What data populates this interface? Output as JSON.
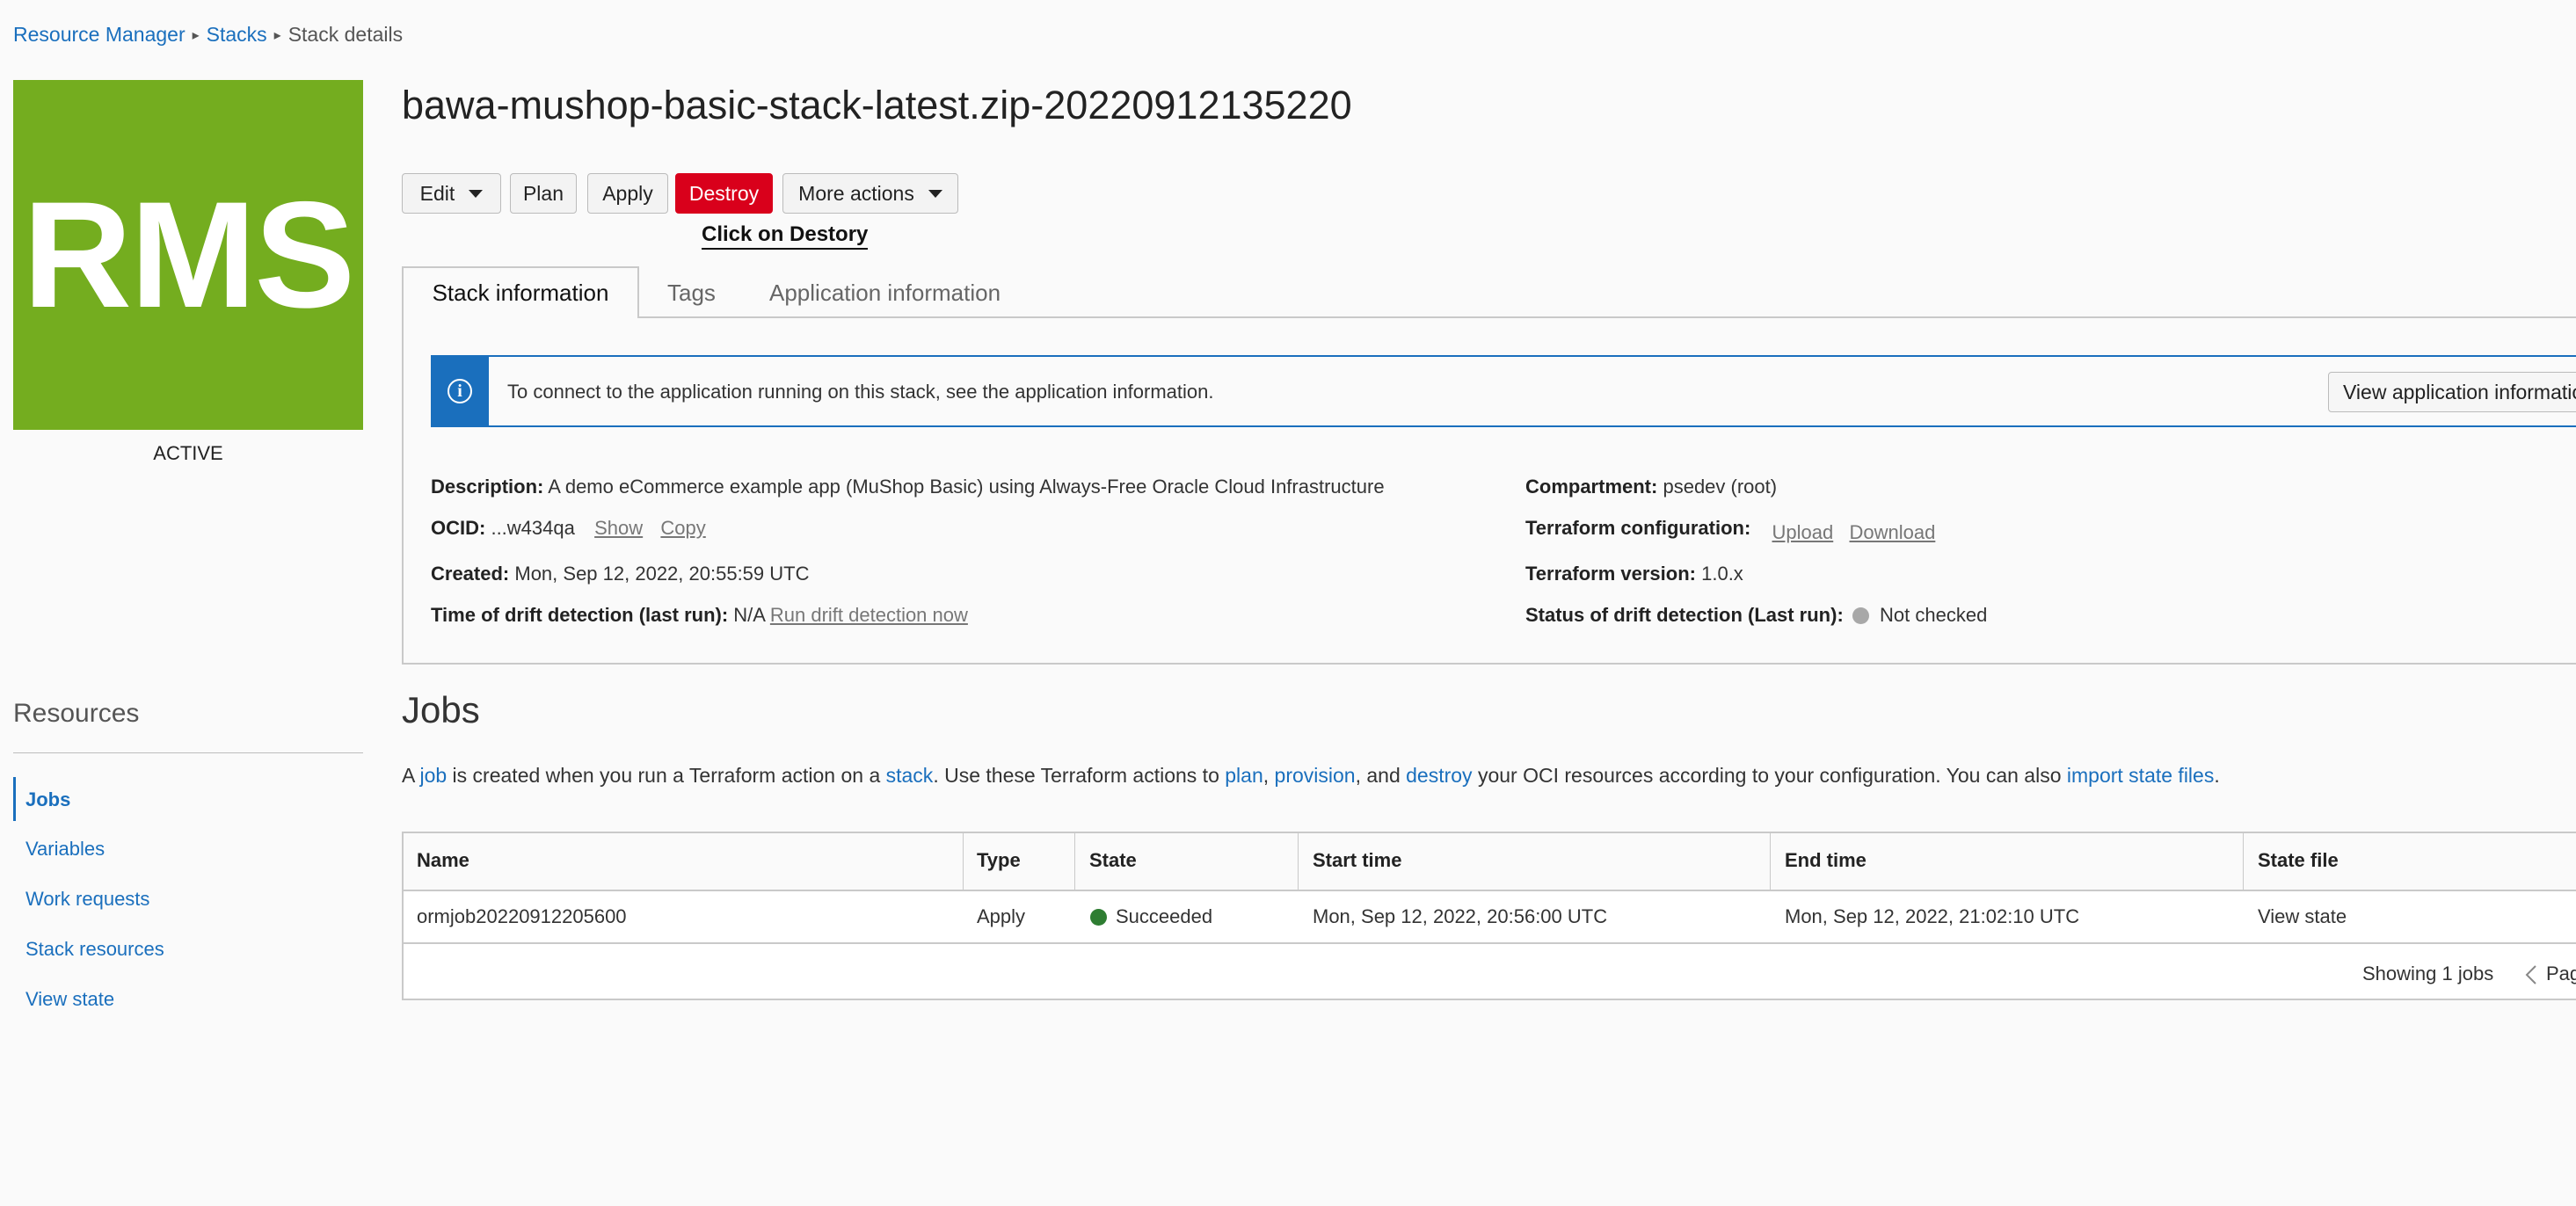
{
  "breadcrumb": {
    "items": [
      "Resource Manager",
      "Stacks"
    ],
    "current": "Stack details"
  },
  "stack": {
    "logo_text": "RMS",
    "status": "ACTIVE",
    "title": "bawa-mushop-basic-stack-latest.zip-20220912135220"
  },
  "toolbar": {
    "edit": "Edit",
    "plan": "Plan",
    "apply": "Apply",
    "destroy": "Destroy",
    "more_actions": "More actions"
  },
  "annotation": "Click on Destory",
  "tabs": [
    "Stack information",
    "Tags",
    "Application information"
  ],
  "info_banner": {
    "text": "To connect to the application running on this stack, see the application information.",
    "button": "View application informatio"
  },
  "details": {
    "description_label": "Description:",
    "description": "A demo eCommerce example app (MuShop Basic) using Always-Free Oracle Cloud Infrastructure",
    "ocid_label": "OCID:",
    "ocid": "...w434qa",
    "show": "Show",
    "copy": "Copy",
    "created_label": "Created:",
    "created": "Mon, Sep 12, 2022, 20:55:59 UTC",
    "drift_time_label": "Time of drift detection (last run):",
    "drift_time": "N/A",
    "run_drift": "Run drift detection now",
    "compartment_label": "Compartment:",
    "compartment": "psedev (root)",
    "tf_config_label": "Terraform configuration:",
    "upload": "Upload",
    "download": "Download",
    "tf_version_label": "Terraform version:",
    "tf_version": "1.0.x",
    "drift_status_label": "Status of drift detection (Last run):",
    "drift_status": "Not checked"
  },
  "resources": {
    "title": "Resources",
    "items": [
      "Jobs",
      "Variables",
      "Work requests",
      "Stack resources",
      "View state"
    ]
  },
  "jobs": {
    "title": "Jobs",
    "desc": {
      "t1": "A ",
      "l1": "job",
      "t2": " is created when you run a Terraform action on a ",
      "l2": "stack",
      "t3": ". Use these Terraform actions to ",
      "l3": "plan",
      "t4": ", ",
      "l4": "provision",
      "t5": ", and ",
      "l5": "destroy",
      "t6": " your OCI resources according to your configuration. You can also ",
      "l6": "import state files",
      "t7": "."
    },
    "columns": [
      "Name",
      "Type",
      "State",
      "Start time",
      "End time",
      "State file"
    ],
    "rows": [
      {
        "name": "ormjob20220912205600",
        "type": "Apply",
        "state": "Succeeded",
        "start": "Mon, Sep 12, 2022, 20:56:00 UTC",
        "end": "Mon, Sep 12, 2022, 21:02:10 UTC",
        "state_file": "View state"
      }
    ],
    "showing": "Showing 1 jobs",
    "pager": "Pag"
  },
  "colors": {
    "accent": "#1a6fbd",
    "destroy": "#d9001b",
    "logo": "#74ad1f",
    "succeeded": "#2e7d32",
    "not_checked": "#a8a8a8"
  },
  "icons": {
    "info": "info-icon",
    "caret": "chevron-down-icon",
    "pager_prev": "chevron-left-icon"
  }
}
